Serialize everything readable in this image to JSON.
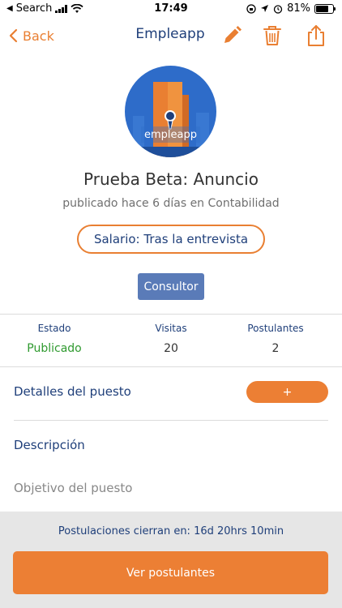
{
  "status_bar": {
    "carrier_back": "Search",
    "time": "17:49",
    "battery": "81%",
    "battery_level": 0.81
  },
  "nav": {
    "back_label": "Back",
    "title": "Empleapp",
    "icons": [
      "pencil-icon",
      "trash-icon",
      "share-icon"
    ]
  },
  "logo": {
    "text": "empleapp"
  },
  "job": {
    "title": "Prueba Beta: Anuncio",
    "subtitle": "publicado hace 6 días en Contabilidad",
    "salary": "Salario: Tras la entrevista",
    "tag": "Consultor"
  },
  "stats": [
    {
      "label": "Estado",
      "value": "Publicado"
    },
    {
      "label": "Visitas",
      "value": "20"
    },
    {
      "label": "Postulantes",
      "value": "2"
    }
  ],
  "sections": {
    "details_label": "Detalles del puesto",
    "details_button": "+",
    "description_label": "Descripción",
    "objective_label": "Objetivo del puesto"
  },
  "footer": {
    "closing_text": "Postulaciones cierran en: 16d 20hrs 10min",
    "cta_label": "Ver postulantes"
  },
  "colors": {
    "accent": "#ec7f34",
    "brand_blue": "#1f3f7a",
    "tag_blue": "#5a7bb8",
    "status_green": "#2f9a2f"
  }
}
